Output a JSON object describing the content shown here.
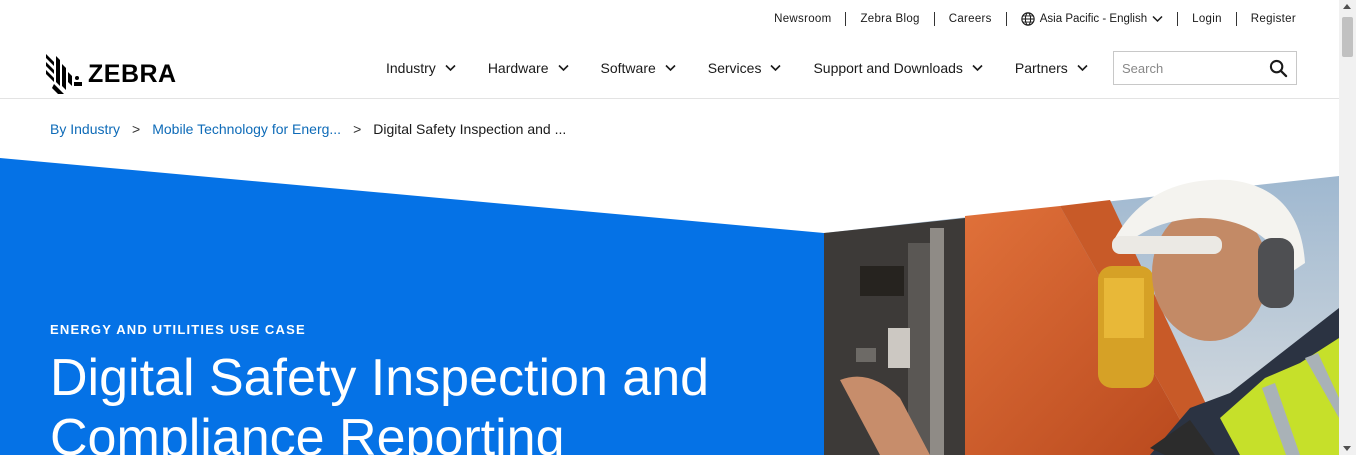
{
  "utility_nav": {
    "newsroom": "Newsroom",
    "blog": "Zebra Blog",
    "careers": "Careers",
    "language": "Asia Pacific - English",
    "login": "Login",
    "register": "Register"
  },
  "brand": {
    "name": "ZEBRA"
  },
  "main_nav": {
    "items": [
      {
        "label": "Industry"
      },
      {
        "label": "Hardware"
      },
      {
        "label": "Software"
      },
      {
        "label": "Services"
      },
      {
        "label": "Support and Downloads"
      },
      {
        "label": "Partners"
      }
    ]
  },
  "search": {
    "placeholder": "Search",
    "value": ""
  },
  "breadcrumb": {
    "items": [
      {
        "label": "By Industry"
      },
      {
        "label": "Mobile Technology for Energ..."
      }
    ],
    "current": "Digital Safety Inspection and ...",
    "separator": ">"
  },
  "hero": {
    "eyebrow": "ENERGY AND UTILITIES USE CASE",
    "title": "Digital Safety Inspection and Compliance Reporting"
  },
  "colors": {
    "hero_blue": "#0572e6",
    "link_blue": "#0e6bb8"
  }
}
